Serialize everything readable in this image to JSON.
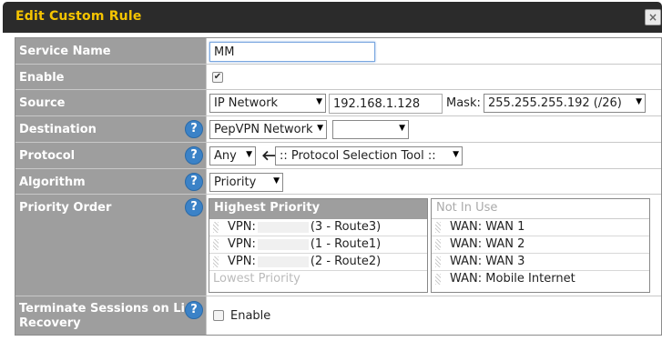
{
  "dialog": {
    "title": "Edit Custom Rule",
    "close_label": "×"
  },
  "service_name": {
    "label": "Service Name",
    "value": "MM"
  },
  "enable": {
    "label": "Enable",
    "checked_glyph": "✔"
  },
  "source": {
    "label": "Source",
    "type_selected": "IP Network",
    "ip_value": "192.168.1.128",
    "mask_label": "Mask:",
    "mask_selected": "255.255.255.192 (/26)"
  },
  "destination": {
    "label": "Destination",
    "type_selected": "PepVPN Network",
    "second_selected": ""
  },
  "protocol": {
    "label": "Protocol",
    "selected": "Any",
    "arrow": "🡐",
    "tool_selected": ":: Protocol Selection Tool ::"
  },
  "algorithm": {
    "label": "Algorithm",
    "selected": "Priority"
  },
  "priority_order": {
    "label": "Priority Order",
    "highest_header": "Highest Priority",
    "lowest_label": "Lowest Priority",
    "in_use": [
      {
        "prefix": "VPN:",
        "suffix": "(3 - Route3)"
      },
      {
        "prefix": "VPN:",
        "suffix": "(1 - Route1)"
      },
      {
        "prefix": "VPN:",
        "suffix": "(2 - Route2)"
      }
    ],
    "not_in_use_header": "Not In Use",
    "not_in_use": [
      "WAN: WAN 1",
      "WAN: WAN 2",
      "WAN: WAN 3",
      "WAN: Mobile Internet"
    ]
  },
  "terminate": {
    "label_line1": "Terminate Sessions on Link",
    "label_line2": "Recovery",
    "enable_label": "Enable"
  },
  "help_glyph": "?",
  "select_arrow": "▼"
}
